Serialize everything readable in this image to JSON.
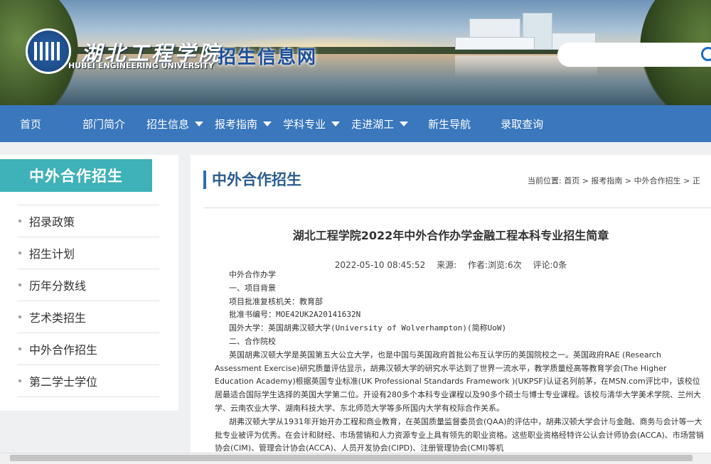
{
  "header": {
    "logo_cn": "湖北工程学院",
    "logo_en": "HUBEI ENGINEERING UNIVERSITY",
    "site_title": "招生信息网",
    "search_placeholder": ""
  },
  "nav": {
    "items": [
      {
        "label": "首页",
        "dropdown": false
      },
      {
        "label": "部门简介",
        "dropdown": false
      },
      {
        "label": "招生信息",
        "dropdown": true
      },
      {
        "label": "报考指南",
        "dropdown": true
      },
      {
        "label": "学科专业",
        "dropdown": true
      },
      {
        "label": "走进湖工",
        "dropdown": true
      },
      {
        "label": "新生导航",
        "dropdown": false
      },
      {
        "label": "录取查询",
        "dropdown": false
      }
    ]
  },
  "sidebar": {
    "title": "中外合作招生",
    "items": [
      "招录政策",
      "招生计划",
      "历年分数线",
      "艺术类招生",
      "中外合作招生",
      "第二学士学位"
    ]
  },
  "main": {
    "section_title": "中外合作招生",
    "breadcrumb": "当前位置: 首页 > 报考指南 > 中外合作招生 > 正",
    "article_title": "湖北工程学院2022年中外合作办学金融工程本科专业招生简章",
    "date": "2022-05-10 08:45:52",
    "source": "来源:",
    "author_views": "作者:浏览:6次",
    "comments": "评论:0条",
    "paragraphs": [
      "中外合作办学",
      "一、项目背景",
      "项目批准复核机关：教育部",
      "批准书编号：MOE42UK2A20141632N",
      "国外大学：英国胡弗汉顿大学(University of Wolverhampton)(简称UoW)",
      "二、合作院校",
      "英国胡弗汉顿大学是英国第五大公立大学，也是中国与英国政府首批公布互认学历的英国院校之一。英国政府RAE (Research Assessment Exercise)研究质量评估显示，胡弗汉顿大学的研究水平达到了世界一流水平，教学质量经高等教育学会(The Higher Education Academy)根据英国专业标准(UK Professional Standards Framework )(UKPSF)认证名列前茅，在MSN.com评比中，该校位居最适合国际学生选择的英国大学第二位。开设有280多个本科专业课程以及90多个硕士与博士专业课程。该校与清华大学美术学院、兰州大学、云南农业大学、湖南科技大学、东北师范大学等多所国内大学有校际合作关系。",
      "胡弗汉顿大学从1931年开始开办工程和商业教育，在英国质量监督委员会(QAA)的评估中，胡弗汉顿大学会计与金融、商务与会计等一大批专业被评为优秀。在会计和财经、市场营销和人力资源专业上具有领先的职业资格。这些职业资格经特许公认会计师协会(ACCA)、市场营销协会(CIM)、管理会计协会(ACCA)、人员开发协会(CIPD)、注册管理协会(CMI)等机"
    ]
  },
  "colors": {
    "nav_bg": "#3a77bc",
    "sidebar_title_bg": "#3fb1b8",
    "section_title": "#2a5d8f"
  }
}
